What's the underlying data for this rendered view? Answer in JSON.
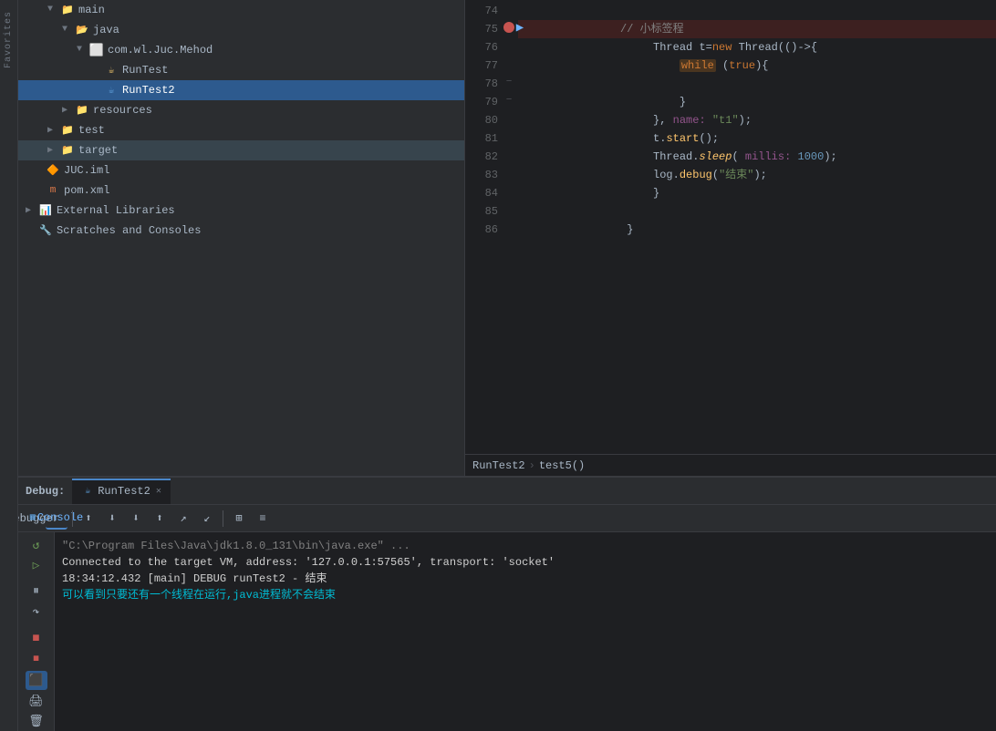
{
  "sidebar": {
    "items": [
      {
        "id": "main",
        "label": "main",
        "indent": "indent-2",
        "type": "folder",
        "expanded": true
      },
      {
        "id": "java",
        "label": "java",
        "indent": "indent-3",
        "type": "folder-src",
        "expanded": true
      },
      {
        "id": "package",
        "label": "com.wl.Juc.Mehod",
        "indent": "indent-4",
        "type": "package",
        "expanded": true
      },
      {
        "id": "RunTest",
        "label": "RunTest",
        "indent": "indent-5",
        "type": "java",
        "selected": false
      },
      {
        "id": "RunTest2",
        "label": "RunTest2",
        "indent": "indent-5",
        "type": "java-blue",
        "selected": true
      },
      {
        "id": "resources",
        "label": "resources",
        "indent": "indent-3",
        "type": "folder",
        "expanded": false
      },
      {
        "id": "test",
        "label": "test",
        "indent": "indent-2",
        "type": "folder",
        "expanded": false
      },
      {
        "id": "target",
        "label": "target",
        "indent": "indent-2",
        "type": "folder",
        "expanded": false,
        "dark": true
      },
      {
        "id": "JUC.iml",
        "label": "JUC.iml",
        "indent": "indent-1",
        "type": "xml"
      },
      {
        "id": "pom.xml",
        "label": "pom.xml",
        "indent": "indent-1",
        "type": "maven"
      },
      {
        "id": "ExternalLibraries",
        "label": "External Libraries",
        "indent": "indent-0",
        "type": "lib",
        "expanded": false
      },
      {
        "id": "ScratchesConsoles",
        "label": "Scratches and Consoles",
        "indent": "indent-0",
        "type": "scratch"
      }
    ]
  },
  "editor": {
    "lines": [
      {
        "num": 74,
        "content": "   // 小标签程",
        "type": "comment"
      },
      {
        "num": 75,
        "content": "        Thread t=new Thread(()->{",
        "breakpoint": true,
        "current": true
      },
      {
        "num": 76,
        "content": "            while (true){",
        "highlight_while": true
      },
      {
        "num": 77,
        "content": ""
      },
      {
        "num": 78,
        "content": "            }",
        "fold": true
      },
      {
        "num": 79,
        "content": "        }, name: \"t1\");",
        "fold": true
      },
      {
        "num": 80,
        "content": "        t.start();",
        "fold": false
      },
      {
        "num": 81,
        "content": "        Thread.sleep( millis: 1000);",
        "fold": false
      },
      {
        "num": 82,
        "content": "        log.debug(\"结束\");",
        "fold": false
      },
      {
        "num": 83,
        "content": "        }"
      },
      {
        "num": 84,
        "content": ""
      },
      {
        "num": 85,
        "content": "    }"
      },
      {
        "num": 86,
        "content": ""
      }
    ],
    "breadcrumb": {
      "class": "RunTest2",
      "method": "test5()"
    }
  },
  "debug": {
    "label": "Debug:",
    "tab_name": "RunTest2",
    "tabs": [
      {
        "id": "debugger",
        "label": "Debugger",
        "active": false
      },
      {
        "id": "console",
        "label": "Console",
        "active": true
      }
    ],
    "toolbar_buttons": [
      {
        "id": "restart",
        "icon": "↺",
        "tooltip": "Restart"
      },
      {
        "id": "sep1",
        "type": "sep"
      },
      {
        "id": "resume",
        "icon": "▷",
        "tooltip": "Resume"
      },
      {
        "id": "pause",
        "icon": "⏸",
        "tooltip": "Pause"
      },
      {
        "id": "stop",
        "icon": "◼",
        "tooltip": "Stop"
      },
      {
        "id": "sep2",
        "type": "sep"
      },
      {
        "id": "step-over",
        "icon": "↷",
        "tooltip": "Step Over"
      },
      {
        "id": "step-into",
        "icon": "↓",
        "tooltip": "Step Into"
      },
      {
        "id": "step-out",
        "icon": "↑",
        "tooltip": "Step Out"
      },
      {
        "id": "force-step",
        "icon": "⇓",
        "tooltip": "Force Step"
      },
      {
        "id": "run-cursor",
        "icon": "→",
        "tooltip": "Run to Cursor"
      },
      {
        "id": "sep3",
        "type": "sep"
      },
      {
        "id": "frames",
        "icon": "≡",
        "tooltip": "Frames"
      },
      {
        "id": "threads",
        "icon": "⊞",
        "tooltip": "Threads"
      }
    ],
    "console_lines": [
      {
        "text": "\"C:\\Program Files\\Java\\jdk1.8.0_131\\bin\\java.exe\" ...",
        "style": "gray"
      },
      {
        "text": "Connected to the target VM, address: '127.0.0.1:57565', transport: 'socket'",
        "style": "white"
      },
      {
        "text": "18:34:12.432 [main] DEBUG runTest2 - 结束",
        "style": "white"
      },
      {
        "text": "可以看到只要还有一个线程在运行,java进程就不会结束",
        "style": "cyan"
      }
    ]
  },
  "favorites_label": "Favorites"
}
